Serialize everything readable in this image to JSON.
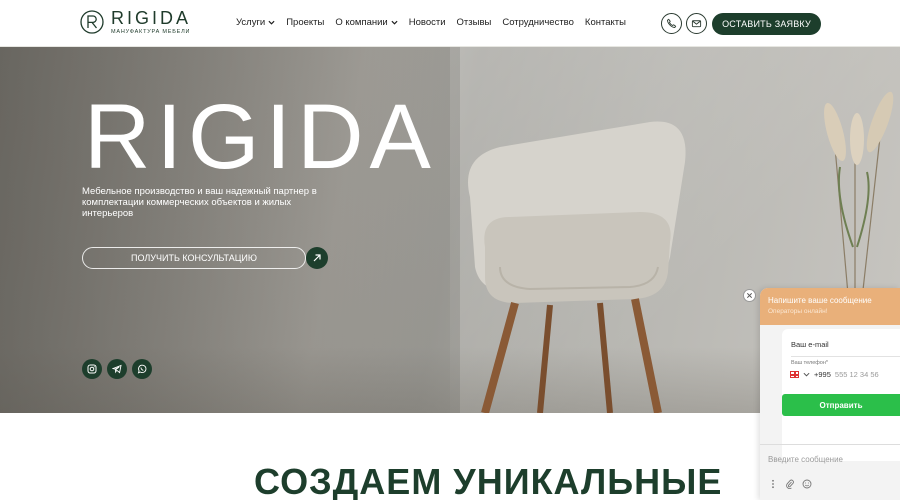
{
  "header": {
    "logo": {
      "name": "RIGIDA",
      "subtitle": "МАНУФАКТУРА МЕБЕЛИ"
    },
    "nav": [
      {
        "label": "Услуги",
        "has_dropdown": true
      },
      {
        "label": "Проекты",
        "has_dropdown": false
      },
      {
        "label": "О компании",
        "has_dropdown": true
      },
      {
        "label": "Новости",
        "has_dropdown": false
      },
      {
        "label": "Отзывы",
        "has_dropdown": false
      },
      {
        "label": "Сотрудничество",
        "has_dropdown": false
      },
      {
        "label": "Контакты",
        "has_dropdown": false
      }
    ],
    "icons": {
      "phone": "phone-icon",
      "mail": "mail-icon"
    },
    "cta_label": "ОСТАВИТЬ ЗАЯВКУ"
  },
  "hero": {
    "title": "RIGIDA",
    "subtitle": "Мебельное производство и ваш надежный партнер в комплектации коммерческих объектов и жилых интерьеров",
    "consult_label": "ПОЛУЧИТЬ КОНСУЛЬТАЦИЮ",
    "social": [
      "instagram-icon",
      "telegram-icon",
      "whatsapp-icon"
    ]
  },
  "section": {
    "title": "СОЗДАЕМ УНИКАЛЬНЫЕ"
  },
  "chat": {
    "title": "Напишите ваше сообщение",
    "status": "Операторы онлайн!",
    "email_placeholder": "Ваш e-mail",
    "phone_label": "Ваш телефон*",
    "phone_code": "+995",
    "phone_placeholder": "555 12 34 56",
    "send_label": "Отправить",
    "message_placeholder": "Введите сообщение"
  },
  "colors": {
    "brand_green": "#1d3e2c",
    "chat_header": "#e9b07a",
    "send_green": "#2bbf4a"
  }
}
